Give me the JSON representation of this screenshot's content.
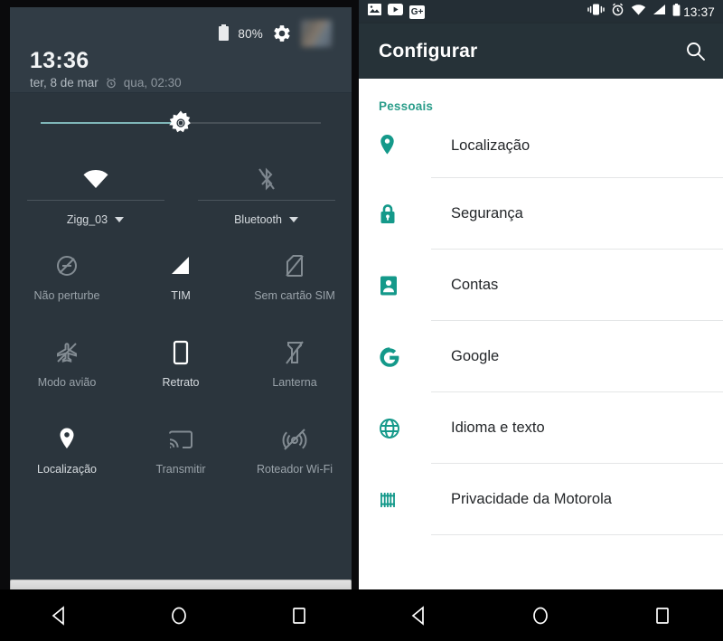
{
  "left_panel": {
    "header": {
      "battery_icon": "battery-icon",
      "battery_percent": "80%",
      "gear_icon": "gear-icon",
      "avatar": "user-avatar",
      "time": "13:36",
      "date": "ter, 8 de mar",
      "alarm_icon": "alarm-icon",
      "alarm_text": "qua, 02:30"
    },
    "brightness": {
      "name": "brightness-slider",
      "value": 50,
      "thumb_icon": "brightness-sun-icon"
    },
    "top_tiles": [
      {
        "icon": "wifi-icon",
        "label": "Zigg_03",
        "state": "on",
        "caret": "chevron-down-icon"
      },
      {
        "icon": "bluetooth-off-icon",
        "label": "Bluetooth",
        "state": "off",
        "caret": "chevron-down-icon"
      }
    ],
    "tiles": [
      {
        "icon": "do-not-disturb-icon",
        "label": "Não perturbe",
        "state": "off"
      },
      {
        "icon": "signal-bars-icon",
        "label": "TIM",
        "state": "on"
      },
      {
        "icon": "no-sim-card-icon",
        "label": "Sem cartão SIM",
        "state": "off"
      },
      {
        "icon": "airplane-mode-off-icon",
        "label": "Modo avião",
        "state": "off"
      },
      {
        "icon": "portrait-rotation-icon",
        "label": "Retrato",
        "state": "on"
      },
      {
        "icon": "flashlight-off-icon",
        "label": "Lanterna",
        "state": "off"
      },
      {
        "icon": "location-pin-icon",
        "label": "Localização",
        "state": "on"
      },
      {
        "icon": "cast-icon",
        "label": "Transmitir",
        "state": "off"
      },
      {
        "icon": "wifi-hotspot-off-icon",
        "label": "Roteador Wi-Fi",
        "state": "off"
      }
    ],
    "handle": "shade-drag-handle",
    "navbar": [
      {
        "icon": "back-icon"
      },
      {
        "icon": "home-icon"
      },
      {
        "icon": "recents-icon"
      }
    ]
  },
  "right_panel": {
    "statusbar": {
      "notif_icons": [
        {
          "icon": "screenshot-image-icon"
        },
        {
          "icon": "youtube-icon"
        },
        {
          "icon": "google-plus-icon",
          "glyph": "G+"
        }
      ],
      "system_icons": [
        {
          "icon": "vibrate-icon"
        },
        {
          "icon": "alarm-icon"
        },
        {
          "icon": "wifi-icon"
        },
        {
          "icon": "signal-bars-icon"
        },
        {
          "icon": "battery-icon"
        }
      ],
      "time": "13:37"
    },
    "actionbar": {
      "title": "Configurar",
      "search_icon": "search-icon"
    },
    "section": {
      "title": "Pessoais"
    },
    "items": [
      {
        "icon": "location-pin-icon",
        "label": "Localização"
      },
      {
        "icon": "lock-icon",
        "label": "Segurança"
      },
      {
        "icon": "account-person-icon",
        "label": "Contas"
      },
      {
        "icon": "google-g-icon",
        "label": "Google"
      },
      {
        "icon": "globe-language-icon",
        "label": "Idioma e texto"
      },
      {
        "icon": "motorola-privacy-icon",
        "label": "Privacidade da Motorola"
      }
    ],
    "navbar": [
      {
        "icon": "back-icon"
      },
      {
        "icon": "home-icon"
      },
      {
        "icon": "recents-icon"
      }
    ]
  },
  "colors": {
    "shade_bg": "#2b353d",
    "shade_header": "#313c45",
    "accent_teal": "#2a9d8a",
    "actionbar": "#263238",
    "statusbar": "#242e35",
    "navbar": "#000000"
  }
}
